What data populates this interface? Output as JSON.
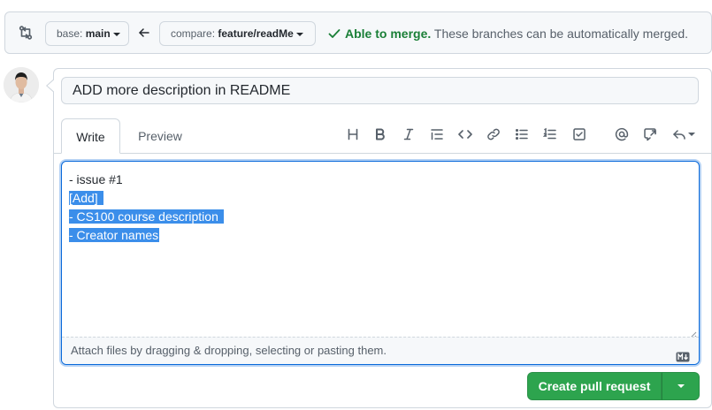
{
  "compare_bar": {
    "base_prefix": "base:",
    "base_branch": "main",
    "compare_prefix": "compare:",
    "compare_branch": "feature/readMe",
    "merge_ok": "Able to merge.",
    "merge_detail": " These branches can be automatically merged."
  },
  "pr": {
    "title": "ADD more description in README",
    "tabs": [
      {
        "label": "Write",
        "active": true
      },
      {
        "label": "Preview",
        "active": false
      }
    ],
    "toolbar": [
      "heading-icon",
      "bold-icon",
      "italic-icon",
      "quote-icon",
      "code-icon",
      "link-icon",
      "unordered-list-icon",
      "ordered-list-icon",
      "task-list-icon",
      "mention-icon",
      "reference-icon",
      "reply-icon"
    ],
    "body_lines": [
      {
        "text": "- issue #1",
        "selected": false
      },
      {
        "text": "[Add]",
        "selected": true
      },
      {
        "text": "- CS100 course description",
        "selected": true
      },
      {
        "text": "- Creator names",
        "selected": true
      }
    ],
    "attach_hint": "Attach files by dragging & dropping, selecting or pasting them.",
    "create_label": "Create pull request"
  },
  "colors": {
    "success": "#1a7f37",
    "button_green": "#2da44e",
    "selection": "#3b8eea",
    "focus": "#0969da"
  }
}
